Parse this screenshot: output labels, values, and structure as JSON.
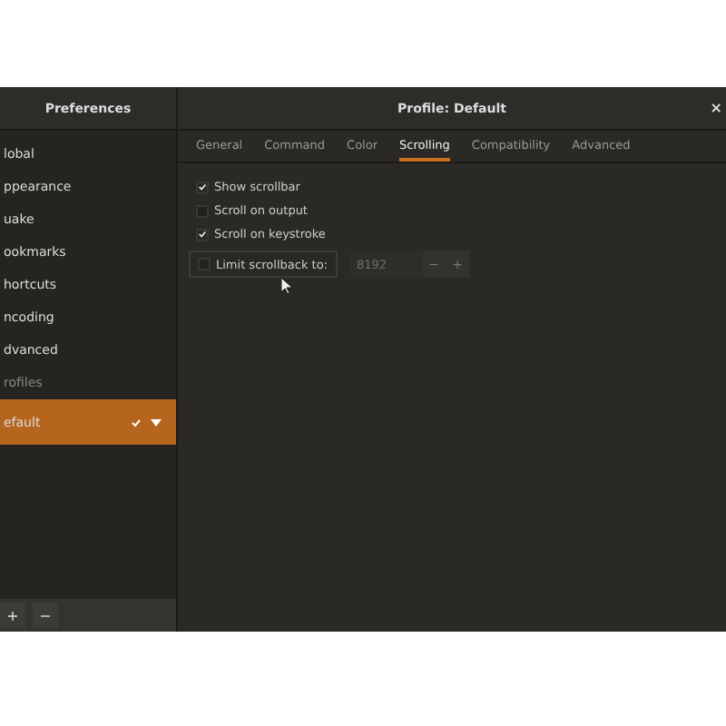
{
  "sidebar": {
    "title": "Preferences",
    "items": [
      {
        "label": "lobal",
        "selected": false
      },
      {
        "label": "ppearance",
        "selected": false
      },
      {
        "label": "uake",
        "selected": false
      },
      {
        "label": "ookmarks",
        "selected": false
      },
      {
        "label": "hortcuts",
        "selected": false
      },
      {
        "label": "ncoding",
        "selected": false
      },
      {
        "label": "dvanced",
        "selected": false
      }
    ],
    "profiles_header": "rofiles",
    "profiles": [
      {
        "label": "efault",
        "selected": true
      }
    ],
    "footer_buttons": [
      "+",
      "−"
    ]
  },
  "main": {
    "title": "Profile: Default",
    "close": "×",
    "tabs": [
      {
        "label": "General",
        "selected": false
      },
      {
        "label": "Command",
        "selected": false
      },
      {
        "label": "Color",
        "selected": false
      },
      {
        "label": "Scrolling",
        "selected": true
      },
      {
        "label": "Compatibility",
        "selected": false
      },
      {
        "label": "Advanced",
        "selected": false
      }
    ],
    "options": [
      {
        "label": "Show scrollbar",
        "checked": true
      },
      {
        "label": "Scroll on output",
        "checked": false
      },
      {
        "label": "Scroll on keystroke",
        "checked": true
      }
    ],
    "limit": {
      "label": "Limit scrollback to:",
      "checked": false,
      "value": "8192",
      "disabled": true,
      "minus": "−",
      "plus": "+"
    }
  }
}
